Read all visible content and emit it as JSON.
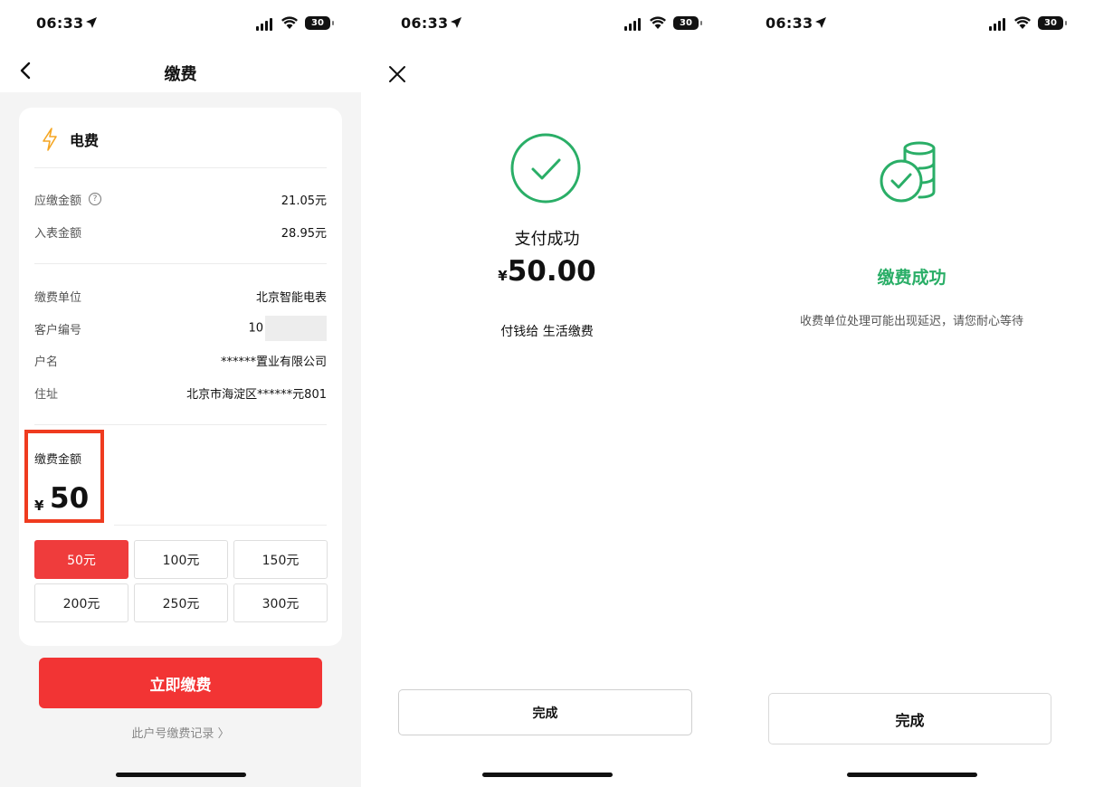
{
  "status_bar": {
    "time": "06:33",
    "battery": "30"
  },
  "panel1": {
    "nav_title": "缴费",
    "bill_type": "电费",
    "due_label": "应缴金额",
    "due_value": "21.05元",
    "meter_label": "入表金额",
    "meter_value": "28.95元",
    "unit_label": "缴费单位",
    "unit_value": "北京智能电表",
    "customer_label": "客户编号",
    "customer_value": "10",
    "account_label": "户名",
    "account_value": "******置业有限公司",
    "address_label": "住址",
    "address_value": "北京市海淀区******元801",
    "amount_label": "缴费金额",
    "currency": "¥",
    "amount_value": "50",
    "chips": [
      "50元",
      "100元",
      "150元",
      "200元",
      "250元",
      "300元"
    ],
    "selected_chip": "50元",
    "pay_button": "立即缴费",
    "record_link": "此户号缴费记录"
  },
  "panel2": {
    "title": "支付成功",
    "currency": "¥",
    "amount": "50.00",
    "payee": "付钱给 生活缴费",
    "done_button": "完成"
  },
  "panel3": {
    "title": "缴费成功",
    "subtitle": "收费单位处理可能出现延迟，请您耐心等待",
    "done_button": "完成"
  },
  "colors": {
    "accent_red": "#f23434",
    "highlight_red": "#ef3b1f",
    "success_green": "#2aae67",
    "bolt_orange": "#f5a623"
  }
}
